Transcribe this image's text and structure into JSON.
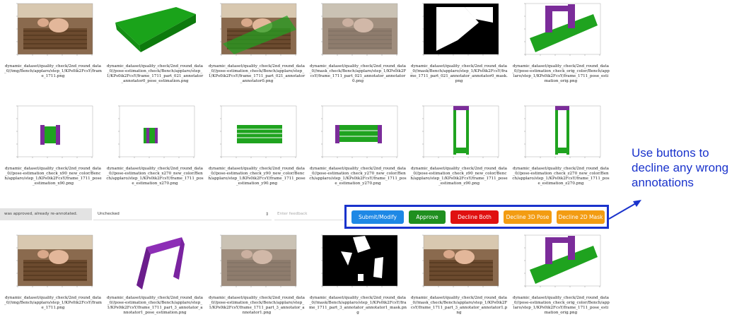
{
  "rows": [
    [
      {
        "kind": "photo",
        "caption": "dynamic_dataset/quality_check/2nd_round_data_0//img/Bench/applaro/step_1/KPs0ik2FcsY/frame_1711.png"
      },
      {
        "kind": "green3d",
        "caption": "dynamic_dataset/quality_check/2nd_round_data_0//pose-estimation_check/Bench/applaro/step_1/KPs0ik2FcsY/frame_1711_part_021_annotator_annotator0_pose_estimation.png"
      },
      {
        "kind": "photo_green",
        "caption": "dynamic_dataset/quality_check/2nd_round_data_0//pose-estimation_check/Bench/applaro/step_1/KPs0ik2FcsY/frame_1711_part_021_annotator_annotator0.png"
      },
      {
        "kind": "photo_gray",
        "caption": "dynamic_dataset/quality_check/2nd_round_data_0//mask_check/Bench/applaro/step_1/KPs0ik2FcsY/frame_1711_part_021_annotator_annotator0.png"
      },
      {
        "kind": "mask",
        "caption": "dynamic_dataset/quality_check/2nd_round_data_0//mask/Bench/applaro/step_1/KPs0ik2FcsY/frame_1711_part_021_annotator_annotator0_mask.png"
      },
      {
        "kind": "bench_plot",
        "caption": "dynamic_dataset/quality_check/2nd_round_data_0//pose-estimation_check_orig_color/Bench/applaro/step_1/KPs0ik2FcsY/frame_1711_pose_estimation_orig.png"
      }
    ],
    [
      {
        "kind": "proj_x",
        "caption": "dynamic_dataset/quality_check/2nd_round_data_0//pose-estimation_check_x90_new_color/Bench/applaro/step_1/KPs0ik2FcsY/frame_1711_pose_estimation_x90.png"
      },
      {
        "kind": "proj_x2",
        "caption": "dynamic_dataset/quality_check/2nd_round_data_0//pose-estimation_check_x270_new_color/Bench/applaro/step_1/KPs0ik2FcsY/frame_1711_pose_estimation_x270.png"
      },
      {
        "kind": "proj_y",
        "caption": "dynamic_dataset/quality_check/2nd_round_data_0//pose-estimation_check_y90_new_color/Bench/applaro/step_1/KPs0ik2FcsY/frame_1711_pose_estimation_y90.png"
      },
      {
        "kind": "proj_y2",
        "caption": "dynamic_dataset/quality_check/2nd_round_data_0//pose-estimation_check_y270_new_color/Bench/applaro/step_1/KPs0ik2FcsY/frame_1711_pose_estimation_y270.png"
      },
      {
        "kind": "proj_z",
        "caption": "dynamic_dataset/quality_check/2nd_round_data_0//pose-estimation_check_z90_new_color/Bench/applaro/step_1/KPs0ik2FcsY/frame_1711_pose_estimation_z90.png"
      },
      {
        "kind": "proj_z2",
        "caption": "dynamic_dataset/quality_check/2nd_round_data_0//pose-estimation_check_z270_new_color/Bench/applaro/step_1/KPs0ik2FcsY/frame_1711_pose_estimation_z270.png"
      }
    ],
    [
      {
        "kind": "photo",
        "caption": "dynamic_dataset/quality_check/2nd_round_data_0//img/Bench/applaro/step_1/KPs0ik2FcsY/frame_1711.png"
      },
      {
        "kind": "purple3d",
        "caption": "dynamic_dataset/quality_check/2nd_round_data_0//pose-estimation_check/Bench/applaro/step_1/KPs0ik2FcsY/frame_1711_part_3_annotator_annotator1_pose_estimation.png"
      },
      {
        "kind": "photo_gray",
        "caption": "dynamic_dataset/quality_check/2nd_round_data_0//pose-estimation_check/Bench/applaro/step_1/KPs0ik2FcsY/frame_1711_part_3_annotator_annotator1.png"
      },
      {
        "kind": "mask2",
        "caption": "dynamic_dataset/quality_check/2nd_round_data_0//mask/Bench/applaro/step_1/KPs0ik2FcsY/frame_1711_part_3_annotator_annotator1_mask.png"
      },
      {
        "kind": "photo",
        "caption": "dynamic_dataset/quality_check/2nd_round_data_0//mask_check/Bench/applaro/step_1/KPs0ik2FcsY/frame_1711_part_3_annotator_annotator1.png"
      },
      {
        "kind": "bench_plot",
        "caption": "dynamic_dataset/quality_check/2nd_round_data_0//pose-estimation_check_orig_color/Bench/applaro/step_1/KPs0ik2FcsY/frame_1711_pose_estimation_orig.png"
      }
    ]
  ],
  "bar": {
    "status": "was approved, already re-annotated.",
    "select_value": "Unchecked",
    "select_arrow": "⇕",
    "feedback_placeholder": "Enter feedback"
  },
  "buttons": [
    {
      "label": "Submit/Modify",
      "color": "#1e88e5"
    },
    {
      "label": "Approve",
      "color": "#1f8f1f"
    },
    {
      "label": "Decline Both",
      "color": "#e01010"
    },
    {
      "label": "Decline 3D Pose",
      "color": "#f39c12"
    },
    {
      "label": "Decline 2D Mask",
      "color": "#f39c12"
    }
  ],
  "note": "Use buttons to decline any wrong annotations"
}
